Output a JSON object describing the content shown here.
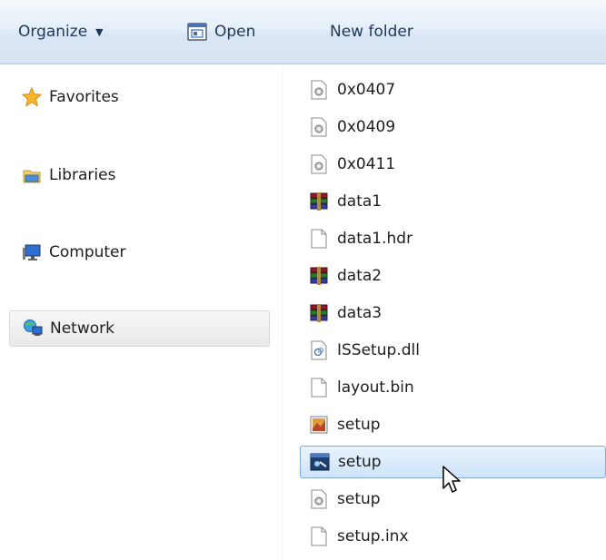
{
  "toolbar": {
    "organize_label": "Organize",
    "open_label": "Open",
    "new_folder_label": "New folder"
  },
  "nav": {
    "items": [
      {
        "label": "Favorites",
        "icon": "star-icon"
      },
      {
        "label": "Libraries",
        "icon": "libraries-icon"
      },
      {
        "label": "Computer",
        "icon": "computer-icon"
      },
      {
        "label": "Network",
        "icon": "network-icon",
        "selected": true
      }
    ]
  },
  "files": [
    {
      "name": "0x0407",
      "icon": "config-file-icon"
    },
    {
      "name": "0x0409",
      "icon": "config-file-icon"
    },
    {
      "name": "0x0411",
      "icon": "config-file-icon"
    },
    {
      "name": "data1",
      "icon": "archive-icon"
    },
    {
      "name": "data1.hdr",
      "icon": "blank-file-icon"
    },
    {
      "name": "data2",
      "icon": "archive-icon"
    },
    {
      "name": "data3",
      "icon": "archive-icon"
    },
    {
      "name": "ISSetup.dll",
      "icon": "dll-icon"
    },
    {
      "name": "layout.bin",
      "icon": "blank-file-icon"
    },
    {
      "name": "setup",
      "icon": "image-file-icon"
    },
    {
      "name": "setup",
      "icon": "setup-exe-icon",
      "selected": true
    },
    {
      "name": "setup",
      "icon": "config-file-icon"
    },
    {
      "name": "setup.inx",
      "icon": "blank-file-icon"
    }
  ],
  "colors": {
    "toolbar_text": "#1e395b",
    "selection_border": "#84acdd",
    "selection_fill": "#cfe4fa"
  }
}
